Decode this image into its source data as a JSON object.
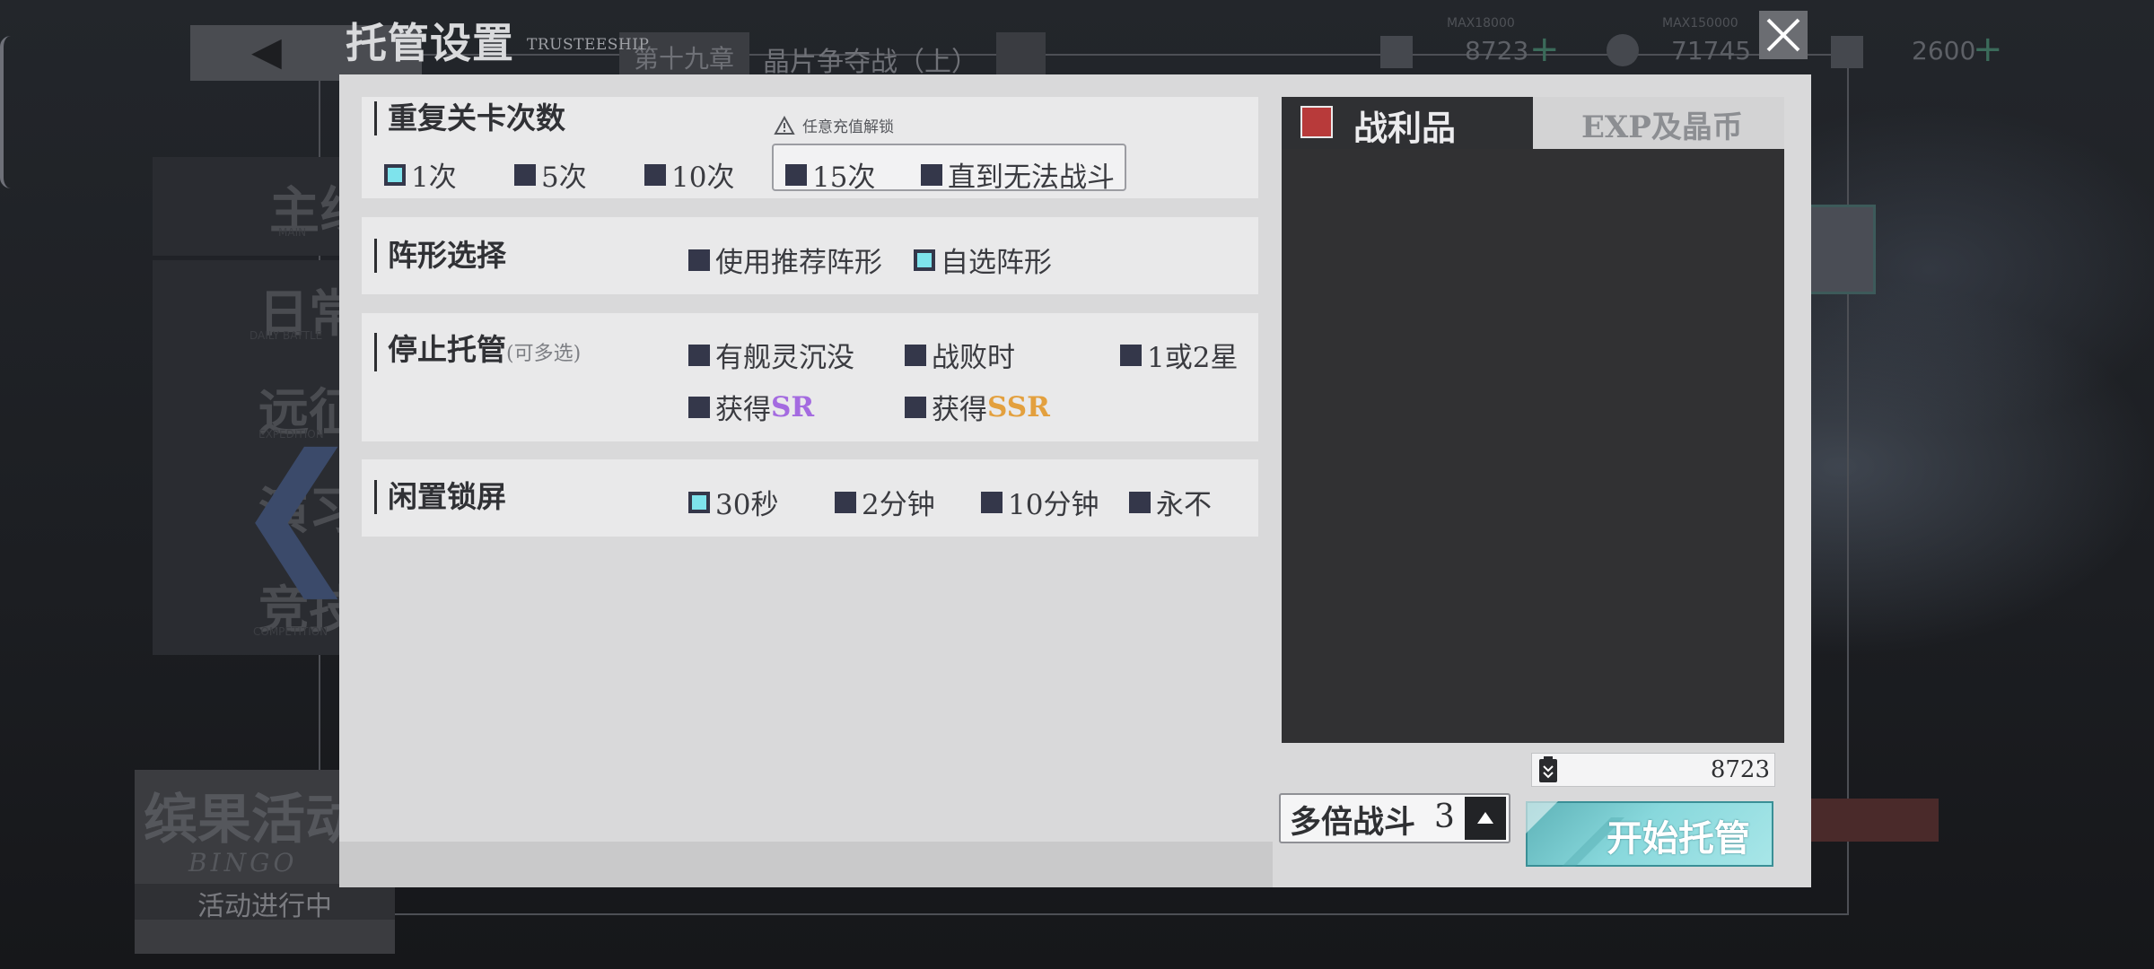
{
  "modal": {
    "title": "托管设置",
    "subtitle": "TRUSTEESHIP"
  },
  "background": {
    "chapter": "第十九章",
    "stage": "晶片争夺战（上）",
    "resources": [
      {
        "max": "MAX18000",
        "value": "8723"
      },
      {
        "max": "MAX150000",
        "value": "71745"
      },
      {
        "value": "2600"
      }
    ],
    "menu": [
      {
        "label": "主线",
        "sub": "MAIN"
      },
      {
        "label": "日常",
        "sub": "DAILY BATTLE"
      },
      {
        "label": "远征",
        "sub": "EXPEDITION"
      },
      {
        "label": "演习",
        "sub": ""
      },
      {
        "label": "竞技",
        "sub": "COMPETITION"
      }
    ],
    "event": {
      "title": "缤果活动",
      "brand": "BINGO",
      "status": "活动进行中"
    }
  },
  "repeat": {
    "title": "重复关卡次数",
    "unlock_hint": "任意充值解锁",
    "options": [
      "1次",
      "5次",
      "10次",
      "15次",
      "直到无法战斗"
    ],
    "selected": "1次"
  },
  "formation": {
    "title": "阵形选择",
    "options": [
      "使用推荐阵形",
      "自选阵形"
    ],
    "selected": "自选阵形"
  },
  "stop": {
    "title": "停止托管",
    "note": "(可多选)",
    "options": [
      "有舰灵沉没",
      "战败时",
      "1或2星"
    ],
    "obtain_prefix": "获得",
    "obtain_sr": "SR",
    "obtain_ssr": "SSR"
  },
  "idle": {
    "title": "闲置锁屏",
    "options": [
      "30秒",
      "2分钟",
      "10分钟",
      "永不"
    ],
    "selected": "30秒"
  },
  "rewards": {
    "tab_loot": "战利品",
    "tab_exp": "EXP及晶币",
    "active_tab": "战利品",
    "resource_value": "8723"
  },
  "multi_battle": {
    "label": "多倍战斗",
    "value": "3"
  },
  "start_button": "开始托管",
  "colors": {
    "checked": "#7ee3ec",
    "unchecked": "#34374a",
    "sr": "#a46be0",
    "ssr": "#e3a03e",
    "start_button": "#88d8dc"
  }
}
